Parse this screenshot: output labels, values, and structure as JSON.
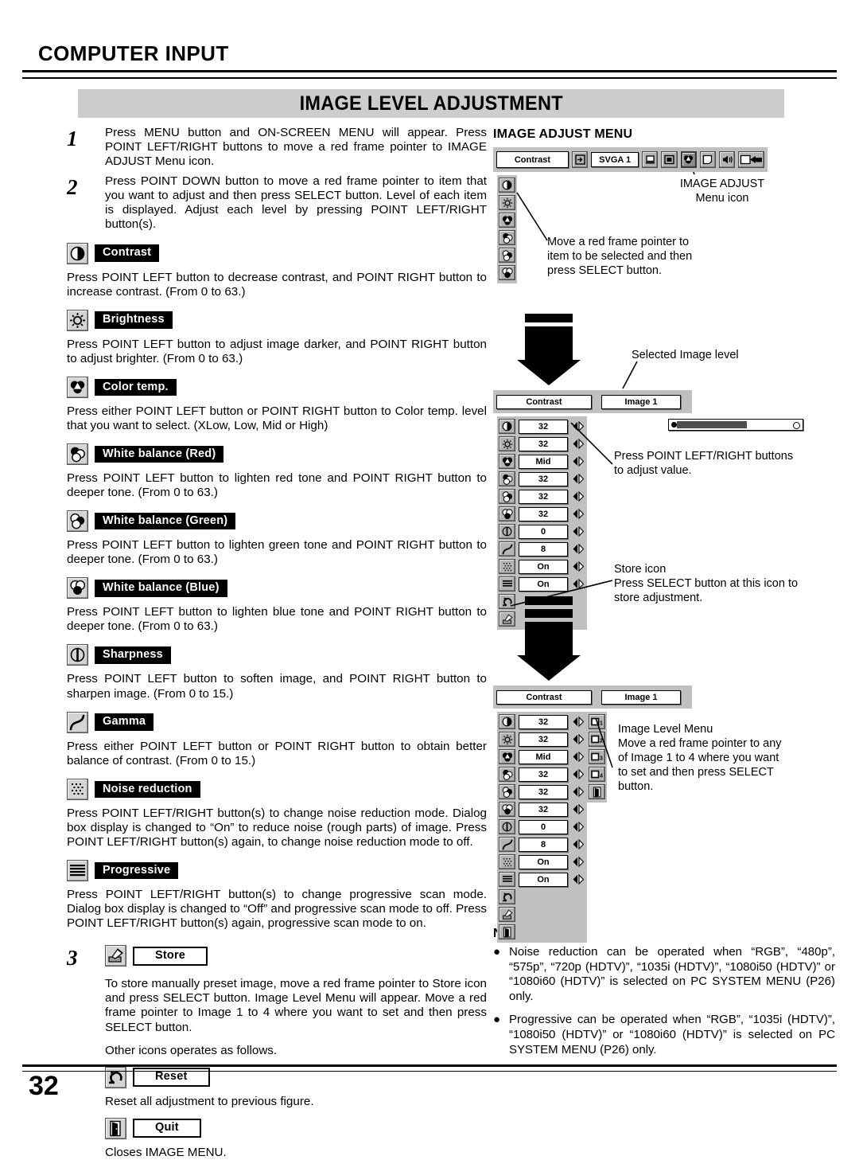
{
  "header": {
    "chapter": "COMPUTER INPUT",
    "banner_title": "IMAGE LEVEL ADJUSTMENT",
    "page_number": "32"
  },
  "steps": [
    {
      "num": "1",
      "text": "Press MENU button and ON-SCREEN MENU will appear.  Press POINT LEFT/RIGHT buttons to move a red frame pointer to IMAGE ADJUST Menu icon."
    },
    {
      "num": "2",
      "text": "Press POINT DOWN button to move a red frame pointer to item that you want to adjust and then press SELECT button. Level of each item is displayed. Adjust each level by pressing POINT LEFT/RIGHT button(s)."
    }
  ],
  "items": [
    {
      "icon": "contrast-icon",
      "label": "Contrast",
      "text": "Press POINT LEFT button to decrease contrast, and POINT RIGHT button to increase contrast.  (From 0 to 63.)"
    },
    {
      "icon": "brightness-icon",
      "label": "Brightness",
      "text": "Press POINT LEFT button to adjust image darker, and POINT RIGHT button to adjust brighter.  (From 0 to 63.)"
    },
    {
      "icon": "color-temp-icon",
      "label": "Color temp.",
      "text": "Press either POINT LEFT button or POINT RIGHT button to Color temp. level that you want to select. (XLow, Low, Mid or High)"
    },
    {
      "icon": "white-balance-red-icon",
      "label": "White balance (Red)",
      "text": "Press POINT LEFT button to lighten red tone and POINT RIGHT button to deeper tone.  (From 0 to 63.)"
    },
    {
      "icon": "white-balance-green-icon",
      "label": "White balance (Green)",
      "text": "Press POINT LEFT button to lighten green tone and POINT RIGHT button to deeper tone.  (From 0 to 63.)"
    },
    {
      "icon": "white-balance-blue-icon",
      "label": "White balance (Blue)",
      "text": "Press POINT LEFT button to lighten blue tone and POINT RIGHT button to deeper tone.  (From 0 to 63.)"
    },
    {
      "icon": "sharpness-icon",
      "label": "Sharpness",
      "text": "Press POINT LEFT button to soften image, and POINT RIGHT button to sharpen image.  (From 0 to 15.)"
    },
    {
      "icon": "gamma-icon",
      "label": "Gamma",
      "text": "Press either POINT LEFT button or POINT RIGHT button to obtain better balance of contrast.  (From 0 to 15.)"
    },
    {
      "icon": "noise-reduction-icon",
      "label": "Noise reduction",
      "text": "Press POINT LEFT/RIGHT button(s) to change noise reduction mode.  Dialog box display is changed to “On” to reduce noise (rough parts) of  image. Press POINT LEFT/RIGHT button(s) again, to change noise reduction mode to off."
    },
    {
      "icon": "progressive-icon",
      "label": "Progressive",
      "text": "Press POINT LEFT/RIGHT button(s) to change progressive scan mode. Dialog box display is changed to “Off” and progressive scan mode to off. Press POINT LEFT/RIGHT button(s) again, progressive scan mode to on."
    }
  ],
  "store_step": {
    "num": "3",
    "icon": "store-icon",
    "label": "Store",
    "text": "To store manually preset image, move a red frame pointer to Store icon and press SELECT button.  Image Level Menu will appear.  Move a red frame pointer to Image 1 to 4 where you want to set and then press SELECT button.",
    "other_icons_note": "Other icons operates as follows."
  },
  "other_icons": [
    {
      "icon": "reset-icon",
      "label": "Reset",
      "text": "Reset all adjustment to previous figure."
    },
    {
      "icon": "quit-icon",
      "label": "Quit",
      "text": "Closes IMAGE MENU."
    }
  ],
  "osd": {
    "menu_title": "IMAGE ADJUST MENU",
    "top_bar": {
      "current_label": "Contrast",
      "source_label": "SVGA 1",
      "icons": [
        "input-icon",
        "computer-icon",
        "screen-icon",
        "image-adjust-icon",
        "pc-adjust-icon",
        "sound-icon",
        "setting-icon"
      ],
      "selected_icon": "image-adjust-icon"
    },
    "callouts": {
      "menu_icon": "IMAGE ADJUST\nMenu icon",
      "menu_icon_line1": "IMAGE ADJUST",
      "menu_icon_line2": "Menu icon",
      "move_pointer": "Move a red frame pointer to item to be selected and then press SELECT button.",
      "move_pointer_l1": "Move a red frame pointer to",
      "move_pointer_l2": "item to be selected and then",
      "move_pointer_l3": "press SELECT button.",
      "selected_image_level": "Selected Image level",
      "adjust_value_l1": "Press POINT LEFT/RIGHT buttons",
      "adjust_value_l2": "to adjust value.",
      "store_icon_l1": "Store icon",
      "store_icon_l2": "Press SELECT button at this icon to",
      "store_icon_l3": "store adjustment.",
      "image_level_menu_l1": "Image Level Menu",
      "image_level_menu_l2": "Move a red frame pointer to any",
      "image_level_menu_l3": "of Image 1 to 4 where you want",
      "image_level_menu_l4": "to set  and then press SELECT",
      "image_level_menu_l5": "button."
    },
    "panel": {
      "title_left": "Contrast",
      "title_right": "Image 1",
      "rows": [
        {
          "icon": "contrast-icon",
          "value": "32"
        },
        {
          "icon": "brightness-icon",
          "value": "32"
        },
        {
          "icon": "color-temp-icon",
          "value": "Mid"
        },
        {
          "icon": "white-balance-red-icon",
          "value": "32"
        },
        {
          "icon": "white-balance-green-icon",
          "value": "32"
        },
        {
          "icon": "white-balance-blue-icon",
          "value": "32"
        },
        {
          "icon": "sharpness-icon",
          "value": "0"
        },
        {
          "icon": "gamma-icon",
          "value": "8"
        },
        {
          "icon": "noise-reduction-icon",
          "value": "On"
        },
        {
          "icon": "progressive-icon",
          "value": "On"
        }
      ],
      "footer_icons": [
        "reset-icon",
        "store-icon",
        "quit-icon"
      ],
      "slider_percent": 50
    },
    "image_level_icons": [
      "image-1-icon",
      "image-2-icon",
      "image-3-icon",
      "image-4-icon",
      "quit-icon"
    ],
    "image_level_numbers": [
      "1",
      "2",
      "3",
      "4"
    ]
  },
  "note": {
    "title": "NOTE :",
    "bullet_glyph": "●",
    "items": [
      "Noise reduction can be operated when  “RGB”, “480p”, “575p”, “720p (HDTV)”, “1035i (HDTV)”, “1080i50 (HDTV)” or “1080i60 (HDTV)” is selected on PC SYSTEM MENU (P26) only.",
      "Progressive can be operated when  “RGB”, “1035i (HDTV)”, “1080i50 (HDTV)” or “1080i60 (HDTV)” is selected on PC SYSTEM MENU (P26) only."
    ]
  }
}
